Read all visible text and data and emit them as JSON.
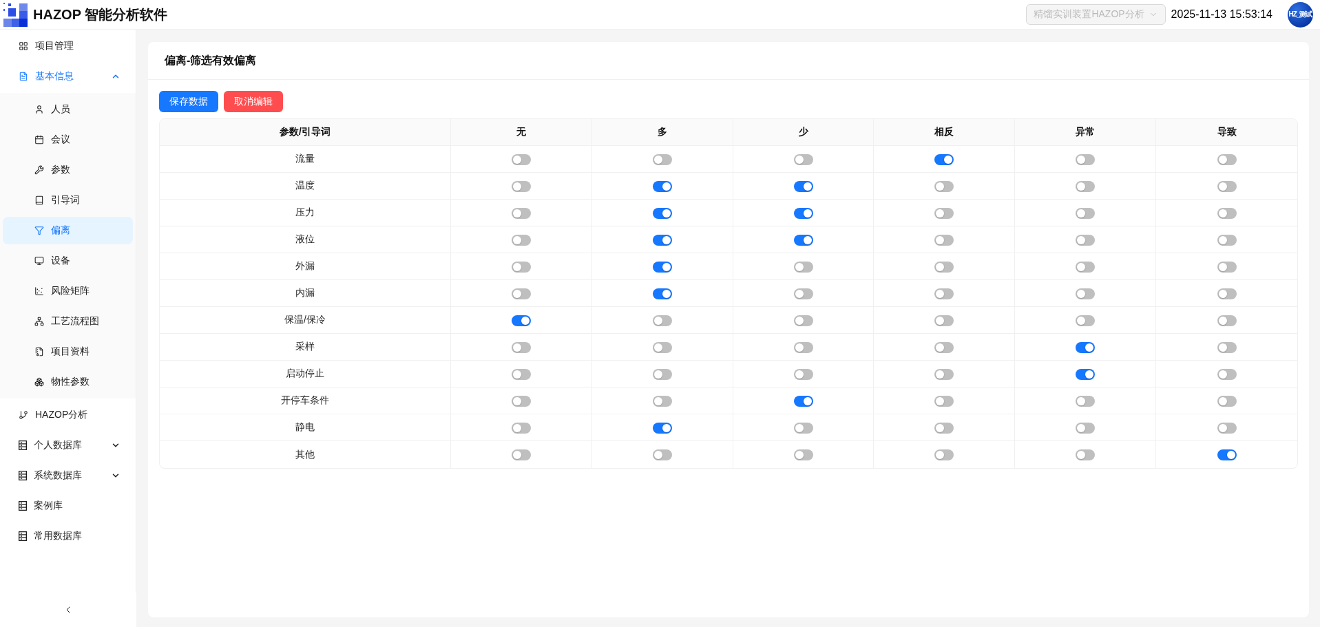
{
  "app": {
    "title": "HAZOP 智能分析软件"
  },
  "header": {
    "project_select": {
      "value": "精馏实训装置HAZOP分析",
      "disabled": true
    },
    "datetime": "2025-11-13 15:53:14",
    "avatar": "HZ_测试"
  },
  "sidebar": {
    "items": [
      {
        "label": "项目管理",
        "selected": false
      },
      {
        "label": "基本信息",
        "selected": false,
        "expanded": true,
        "children": [
          {
            "label": "人员",
            "selected": false
          },
          {
            "label": "会议",
            "selected": false
          },
          {
            "label": "参数",
            "selected": false
          },
          {
            "label": "引导词",
            "selected": false
          },
          {
            "label": "偏离",
            "selected": true
          },
          {
            "label": "设备",
            "selected": false
          },
          {
            "label": "风险矩阵",
            "selected": false
          },
          {
            "label": "工艺流程图",
            "selected": false
          },
          {
            "label": "项目资料",
            "selected": false
          },
          {
            "label": "物性参数",
            "selected": false
          }
        ]
      },
      {
        "label": "HAZOP分析",
        "selected": false
      },
      {
        "label": "个人数据库",
        "selected": false,
        "expanded": false
      },
      {
        "label": "系统数据库",
        "selected": false,
        "expanded": false
      },
      {
        "label": "案例库",
        "selected": false
      },
      {
        "label": "常用数据库",
        "selected": false
      }
    ]
  },
  "card": {
    "title": "偏离-筛选有效偏离",
    "buttons": [
      {
        "label": "保存数据",
        "kind": "primary"
      },
      {
        "label": "取消编辑",
        "kind": "danger"
      }
    ]
  },
  "table": {
    "columns": [
      "参数/引导词",
      "无",
      "多",
      "少",
      "相反",
      "异常",
      "导致"
    ],
    "rows": [
      {
        "parameter": "流量",
        "switches": [
          {
            "on": false
          },
          {
            "on": false
          },
          {
            "on": false
          },
          {
            "on": true
          },
          {
            "on": false
          },
          {
            "on": false
          }
        ]
      },
      {
        "parameter": "温度",
        "switches": [
          {
            "on": false
          },
          {
            "on": true
          },
          {
            "on": true
          },
          {
            "on": false
          },
          {
            "on": false
          },
          {
            "on": false
          }
        ]
      },
      {
        "parameter": "压力",
        "switches": [
          {
            "on": false
          },
          {
            "on": true
          },
          {
            "on": true
          },
          {
            "on": false
          },
          {
            "on": false
          },
          {
            "on": false
          }
        ]
      },
      {
        "parameter": "液位",
        "switches": [
          {
            "on": false
          },
          {
            "on": true
          },
          {
            "on": true
          },
          {
            "on": false
          },
          {
            "on": false
          },
          {
            "on": false
          }
        ]
      },
      {
        "parameter": "外漏",
        "switches": [
          {
            "on": false
          },
          {
            "on": true
          },
          {
            "on": false
          },
          {
            "on": false
          },
          {
            "on": false
          },
          {
            "on": false
          }
        ]
      },
      {
        "parameter": "内漏",
        "switches": [
          {
            "on": false
          },
          {
            "on": true
          },
          {
            "on": false
          },
          {
            "on": false
          },
          {
            "on": false
          },
          {
            "on": false
          }
        ]
      },
      {
        "parameter": "保温/保冷",
        "switches": [
          {
            "on": true
          },
          {
            "on": false
          },
          {
            "on": false
          },
          {
            "on": false
          },
          {
            "on": false
          },
          {
            "on": false
          }
        ]
      },
      {
        "parameter": "采样",
        "switches": [
          {
            "on": false
          },
          {
            "on": false
          },
          {
            "on": false
          },
          {
            "on": false
          },
          {
            "on": true
          },
          {
            "on": false
          }
        ]
      },
      {
        "parameter": "启动停止",
        "switches": [
          {
            "on": false
          },
          {
            "on": false
          },
          {
            "on": false
          },
          {
            "on": false
          },
          {
            "on": true
          },
          {
            "on": false
          }
        ]
      },
      {
        "parameter": "开停车条件",
        "switches": [
          {
            "on": false
          },
          {
            "on": false
          },
          {
            "on": true
          },
          {
            "on": false
          },
          {
            "on": false
          },
          {
            "on": false
          }
        ]
      },
      {
        "parameter": "静电",
        "switches": [
          {
            "on": false
          },
          {
            "on": true
          },
          {
            "on": false
          },
          {
            "on": false
          },
          {
            "on": false
          },
          {
            "on": false
          }
        ]
      },
      {
        "parameter": "其他",
        "switches": [
          {
            "on": false
          },
          {
            "on": false
          },
          {
            "on": false
          },
          {
            "on": false
          },
          {
            "on": false
          },
          {
            "on": true
          }
        ]
      }
    ]
  }
}
